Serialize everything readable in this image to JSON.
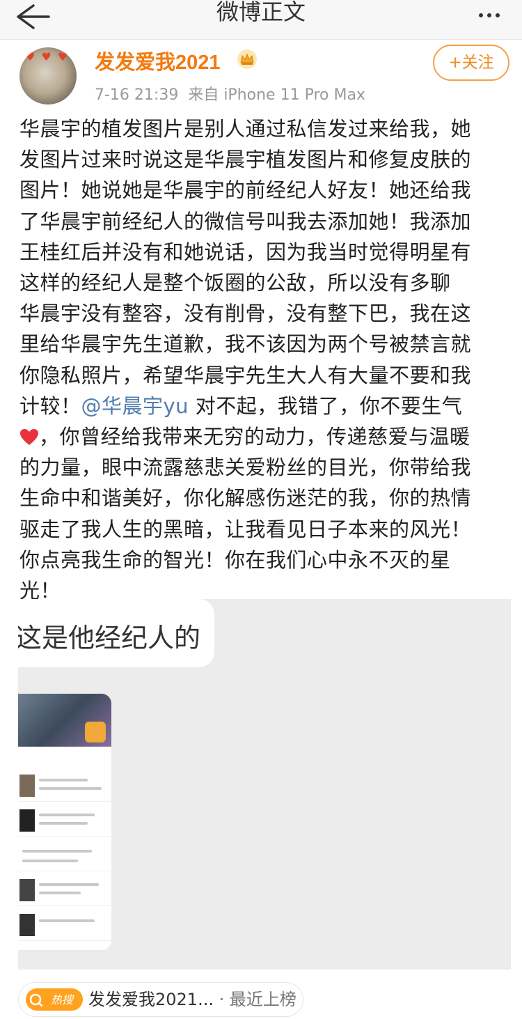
{
  "header": {
    "title": "微博正文",
    "back_icon": "back-arrow-icon",
    "more_icon": "more-dots-icon"
  },
  "post": {
    "username": "发发爱我2021",
    "time": "7-16 21:39",
    "source": "来自 iPhone 11 Pro Max",
    "follow_label": "+关注",
    "lines": [
      "华晨宇的植发图片是别人通过私信发过来给我，她",
      "发图片过来时说这是华晨宇植发图片和修复皮肤的",
      "图片！她说她是华晨宇的前经纪人好友！她还给我",
      "了华晨宇前经纪人的微信号叫我去添加她！我添加",
      "王桂红后并没有和她说话，因为我当时觉得明星有",
      "这样的经纪人是整个饭圈的公敌，所以没有多聊",
      "华晨宇没有整容，没有削骨，没有整下巴，我在这",
      "里给华晨宇先生道歉，我不该因为两个号被禁言就",
      "你隐私照片，希望华晨宇先生大人有大量不要和我"
    ],
    "line10_prefix": "计较！",
    "mention": "@华晨宇yu",
    "line10_suffix": " 对不起，我错了，你不要生气",
    "line11_after_heart": "，你曾经给我带来无穷的动力，传递慈爱与温暖",
    "lines_after": [
      "的力量，眼中流露慈悲关爱粉丝的目光，你带给我",
      "生命中和谐美好，你化解感伤迷茫的我，你的热情",
      "驱走了我人生的黑暗，让我看见日子本来的风光！",
      "你点亮我生命的智光！你在我们心中永不灭的星",
      "光！"
    ],
    "image_caption": "这是他经纪人的"
  },
  "hot_search": {
    "icon_label": "热搜",
    "text": "发发爱我2021...",
    "sub": "· 最近上榜"
  },
  "colors": {
    "accent": "#f47a0e",
    "mention": "#507daf",
    "heart": "#e8323c"
  }
}
